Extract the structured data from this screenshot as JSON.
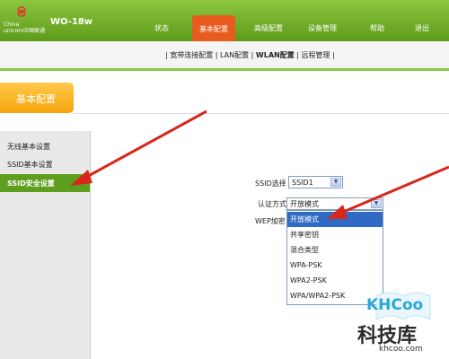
{
  "header": {
    "logo_text_en": "China",
    "logo_text_sub": "unicom中国联通",
    "model": "WO-18w",
    "nav": [
      {
        "label": "状态"
      },
      {
        "label": "基本配置",
        "active": true
      },
      {
        "label": "高级配置"
      },
      {
        "label": "设备管理"
      },
      {
        "label": "帮助"
      },
      {
        "label": "退出"
      }
    ],
    "colors": {
      "bar": "#6aa823",
      "active_tab": "#e85b1f"
    }
  },
  "subnav": {
    "items": [
      "宽带连接配置",
      "LAN配置",
      "WLAN配置",
      "远程管理"
    ],
    "active": "WLAN配置"
  },
  "section": {
    "title": "基本配置",
    "color": "#f6a50c"
  },
  "sidebar": {
    "items": [
      {
        "label": "无线基本设置"
      },
      {
        "label": "SSID基本设置"
      },
      {
        "label": "SSID安全设置",
        "active": true
      }
    ],
    "active_color": "#5d9f1d"
  },
  "form": {
    "ssid_label": "SSID选择",
    "ssid_value": "SSID1",
    "auth_label": "认证方式",
    "auth_value": "开放模式",
    "wep_label": "WEP加密"
  },
  "dropdown": {
    "options": [
      "开放模式",
      "共享密钥",
      "混合类型",
      "WPA-PSK",
      "WPA2-PSK",
      "WPA/WPA2-PSK"
    ],
    "highlighted": "开放模式"
  },
  "watermark": {
    "brand": "KHCoo",
    "cn": "科技库",
    "url": "khcoo.com"
  },
  "icons": {
    "logo": "china-unicom-logo-icon",
    "arrow": "dropdown-arrow-icon",
    "annotation": "red-arrow-annotation"
  }
}
